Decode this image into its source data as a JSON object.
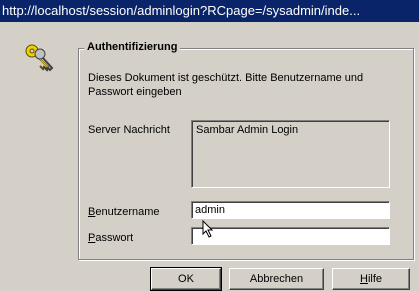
{
  "window": {
    "title": "http://localhost/session/adminlogin?RCpage=/sysadmin/inde..."
  },
  "dialog": {
    "group_title": "Authentifizierung",
    "description": "Dieses Dokument ist geschützt. Bitte Benutzername und Passwort eingeben",
    "server_label": "Server Nachricht",
    "server_message": "Sambar Admin Login",
    "username_label": {
      "accel": "B",
      "rest": "enutzername"
    },
    "username_value": "admin",
    "password_label": {
      "accel": "P",
      "rest": "asswort"
    },
    "password_value": ""
  },
  "buttons": {
    "ok": "OK",
    "cancel": "Abbrechen",
    "help": {
      "accel": "H",
      "rest": "ilfe"
    }
  },
  "colors": {
    "titlebar": "#0a246a",
    "dialog_bg": "#d4d0c8"
  }
}
